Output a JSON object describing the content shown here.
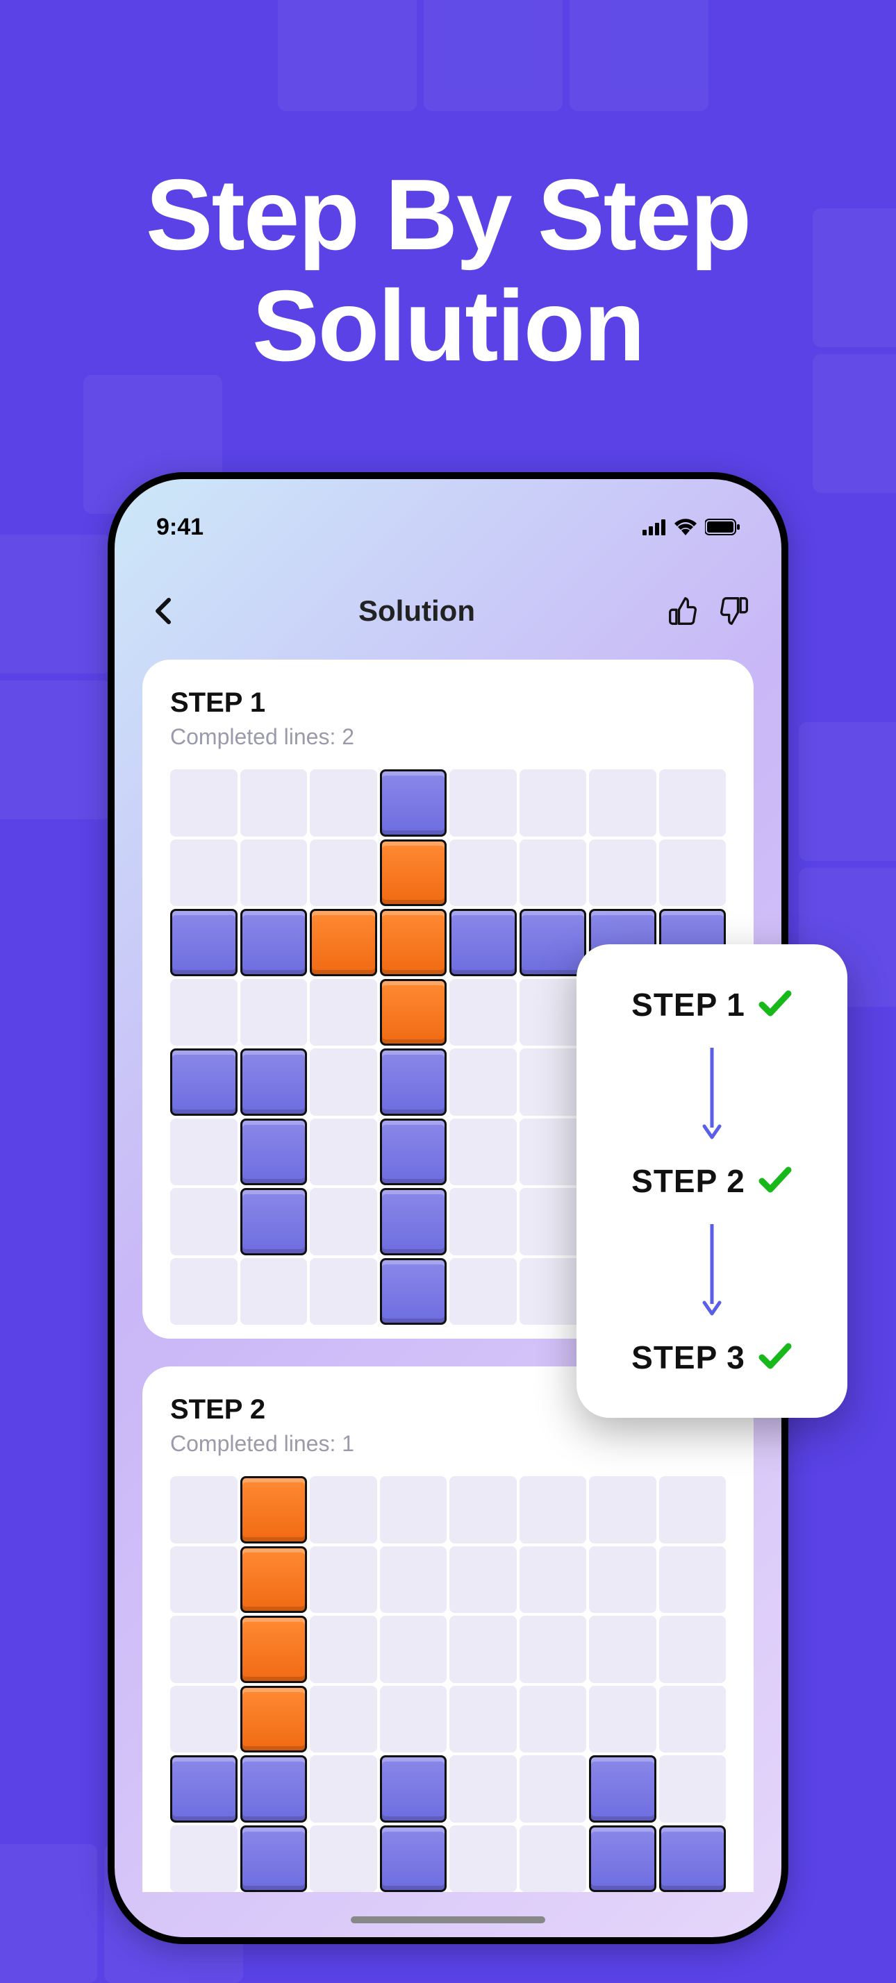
{
  "hero": {
    "line1": "Step By Step",
    "line2": "Solution"
  },
  "status": {
    "time": "9:41"
  },
  "nav": {
    "title": "Solution"
  },
  "steps": [
    {
      "title": "STEP 1",
      "subtitle": "Completed lines: 2",
      "cols": 8,
      "rows": 8,
      "grid": [
        [
          ".",
          ".",
          ".",
          "B",
          ".",
          ".",
          ".",
          "."
        ],
        [
          ".",
          ".",
          ".",
          "O",
          ".",
          ".",
          ".",
          "."
        ],
        [
          "B",
          "B",
          "O",
          "O",
          "B",
          "B",
          "B",
          "B"
        ],
        [
          ".",
          ".",
          ".",
          "O",
          ".",
          ".",
          ".",
          "."
        ],
        [
          "B",
          "B",
          ".",
          "B",
          ".",
          ".",
          ".",
          "."
        ],
        [
          ".",
          "B",
          ".",
          "B",
          ".",
          ".",
          ".",
          "."
        ],
        [
          ".",
          "B",
          ".",
          "B",
          ".",
          ".",
          ".",
          "."
        ],
        [
          ".",
          ".",
          ".",
          "B",
          ".",
          ".",
          ".",
          "."
        ]
      ]
    },
    {
      "title": "STEP 2",
      "subtitle": "Completed lines: 1",
      "cols": 8,
      "rows": 6,
      "grid": [
        [
          ".",
          "O",
          ".",
          ".",
          ".",
          ".",
          ".",
          "."
        ],
        [
          ".",
          "O",
          ".",
          ".",
          ".",
          ".",
          ".",
          "."
        ],
        [
          ".",
          "O",
          ".",
          ".",
          ".",
          ".",
          ".",
          "."
        ],
        [
          ".",
          "O",
          ".",
          ".",
          ".",
          ".",
          ".",
          "."
        ],
        [
          "B",
          "B",
          ".",
          "B",
          ".",
          ".",
          "B",
          "."
        ],
        [
          ".",
          "B",
          ".",
          "B",
          ".",
          ".",
          "B",
          "B"
        ]
      ]
    }
  ],
  "sequence": [
    "STEP 1",
    "STEP 2",
    "STEP 3"
  ]
}
